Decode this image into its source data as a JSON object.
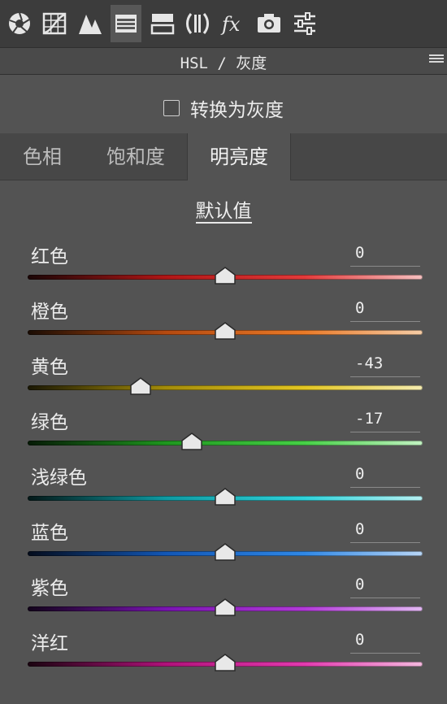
{
  "toolbar": {
    "icons": [
      "aperture-icon",
      "tone-curve-icon",
      "detail-icon",
      "hsl-icon",
      "split-toning-icon",
      "lens-corrections-icon",
      "effects-icon",
      "camera-calibration-icon",
      "presets-icon"
    ],
    "effects_glyph": "fx",
    "active": "hsl-icon"
  },
  "panel": {
    "title": "HSL / 灰度"
  },
  "grayscale": {
    "label": "转换为灰度",
    "checked": false
  },
  "tabs": [
    {
      "label": "色相",
      "active": false
    },
    {
      "label": "饱和度",
      "active": false
    },
    {
      "label": "明亮度",
      "active": true
    }
  ],
  "defaults_link": "默认值",
  "slider_range": [
    -100,
    100
  ],
  "sliders": [
    {
      "label": "红色",
      "value": "0",
      "num": 0,
      "colors": [
        "#1a0606",
        "#b01616",
        "#e23a3a",
        "#f5c0c0"
      ]
    },
    {
      "label": "橙色",
      "value": "0",
      "num": 0,
      "colors": [
        "#1a0c04",
        "#b54a10",
        "#ea7a28",
        "#f6cda6"
      ]
    },
    {
      "label": "黄色",
      "value": "-43",
      "num": -43,
      "colors": [
        "#1a1704",
        "#a48c0a",
        "#e3c622",
        "#f5ecb0"
      ]
    },
    {
      "label": "绿色",
      "value": "-17",
      "num": -17,
      "colors": [
        "#061a06",
        "#1e961e",
        "#46d046",
        "#c2f2c2"
      ]
    },
    {
      "label": "浅绿色",
      "value": "0",
      "num": 0,
      "colors": [
        "#041818",
        "#0f9aa2",
        "#2fd2da",
        "#b6f0f2"
      ]
    },
    {
      "label": "蓝色",
      "value": "0",
      "num": 0,
      "colors": [
        "#040c1c",
        "#1257b6",
        "#2f88e6",
        "#b8d6f6"
      ]
    },
    {
      "label": "紫色",
      "value": "0",
      "num": 0,
      "colors": [
        "#12041a",
        "#7a14b2",
        "#b23ad8",
        "#e2b8f2"
      ]
    },
    {
      "label": "洋红",
      "value": "0",
      "num": 0,
      "colors": [
        "#1a0410",
        "#b0127a",
        "#e23aae",
        "#f4b8de"
      ]
    }
  ]
}
